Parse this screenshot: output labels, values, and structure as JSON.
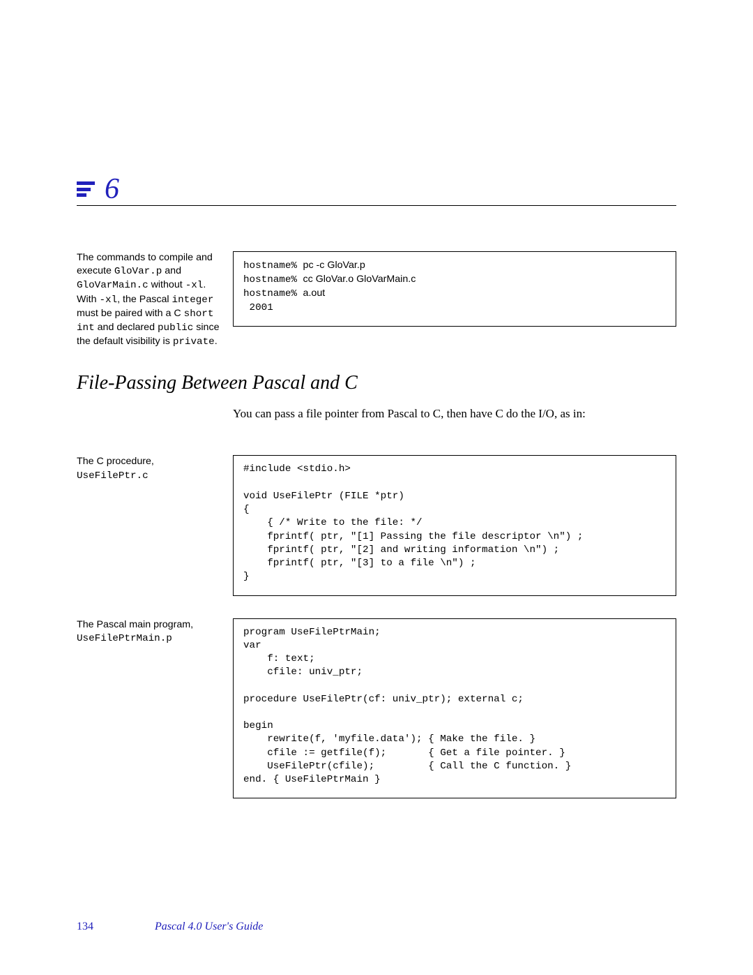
{
  "chapter": {
    "number": "6"
  },
  "block1": {
    "sidebar_html": "The commands to compile and execute <code>GloVar.p</code> and <code>GloVarMain.c</code> without <code>-xl</code>. With <code>-xl</code>, the Pascal <code>integer</code> must be paired with a C <code>short int</code> and declared <code>public</code> since the default visibility is <code>private</code>.",
    "code_html": "hostname% <span class=\"sans\">pc -c GloVar.p</span>\nhostname% <span class=\"sans\">cc GloVar.o GloVarMain.c</span>\nhostname% <span class=\"sans\">a.out</span>\n 2001"
  },
  "section": {
    "title": "File-Passing Between Pascal and C",
    "intro": "You can pass a file pointer from Pascal to C, then have C do the I/O, as in:"
  },
  "block2": {
    "sidebar_html": "The C procedure,<br><code>UseFilePtr.c</code>",
    "code": "#include <stdio.h>\n\nvoid UseFilePtr (FILE *ptr)\n{\n    { /* Write to the file: */\n    fprintf( ptr, \"[1] Passing the file descriptor \\n\") ;\n    fprintf( ptr, \"[2] and writing information \\n\") ;\n    fprintf( ptr, \"[3] to a file \\n\") ;\n}"
  },
  "block3": {
    "sidebar_html": "The Pascal  main program,<br><code>UseFilePtrMain.p</code>",
    "code": "program UseFilePtrMain;\nvar\n    f: text;\n    cfile: univ_ptr;\n\nprocedure UseFilePtr(cf: univ_ptr); external c;\n\nbegin\n    rewrite(f, 'myfile.data'); { Make the file. }\n    cfile := getfile(f);       { Get a file pointer. }\n    UseFilePtr(cfile);         { Call the C function. }\nend. { UseFilePtrMain }"
  },
  "footer": {
    "page": "134",
    "book": "Pascal 4.0 User's Guide"
  }
}
